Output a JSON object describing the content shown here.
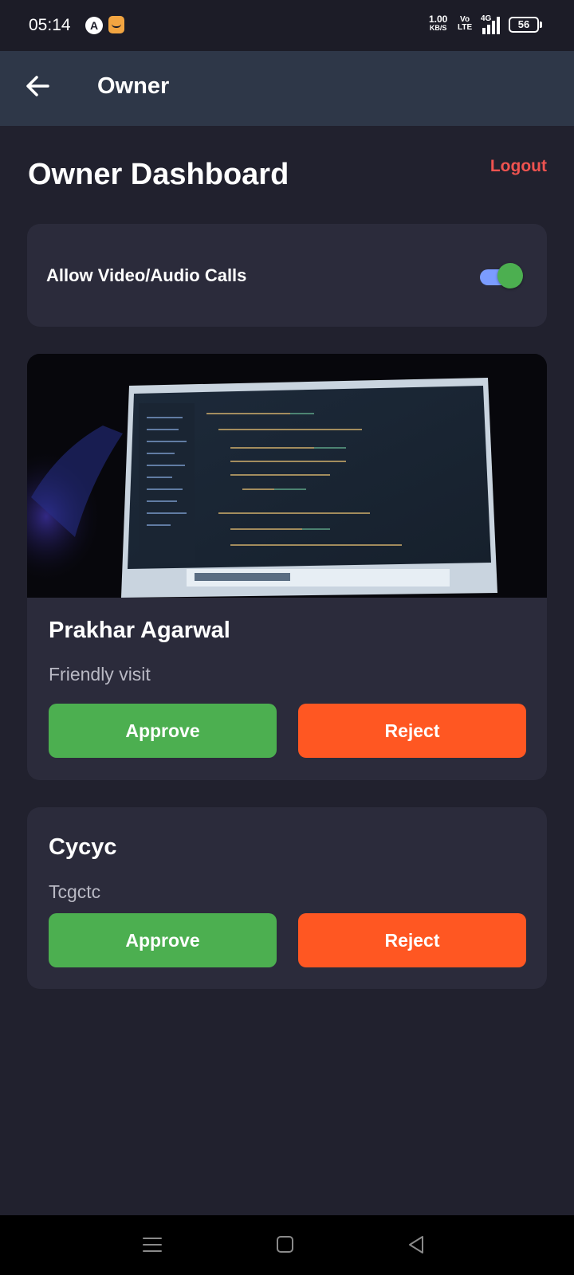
{
  "status_bar": {
    "time": "05:14",
    "app_icon_1": "A",
    "net_speed_value": "1.00",
    "net_speed_unit": "KB/S",
    "volte_top": "Vo",
    "volte_bottom": "LTE",
    "network_type": "4G",
    "battery": "56"
  },
  "app_bar": {
    "back_icon": "arrow-left-icon",
    "title": "Owner"
  },
  "dashboard": {
    "title": "Owner Dashboard",
    "logout_label": "Logout",
    "toggle": {
      "label": "Allow Video/Audio Calls",
      "enabled": true
    }
  },
  "visitors": [
    {
      "has_photo": true,
      "name": "Prakhar Agarwal",
      "purpose": "Friendly visit",
      "approve_label": "Approve",
      "reject_label": "Reject"
    },
    {
      "has_photo": false,
      "name": "Cycyc",
      "purpose": "Tcgctc",
      "approve_label": "Approve",
      "reject_label": "Reject"
    }
  ],
  "colors": {
    "background": "#21212e",
    "app_bar": "#2e3748",
    "card": "#2b2b3b",
    "logout": "#ef5350",
    "approve": "#4caf50",
    "reject": "#ff5722",
    "switch_track": "#7b9cff",
    "switch_thumb": "#4caf50"
  },
  "nav_bar": {
    "icons": [
      "menu-icon",
      "home-icon",
      "back-triangle-icon"
    ]
  }
}
